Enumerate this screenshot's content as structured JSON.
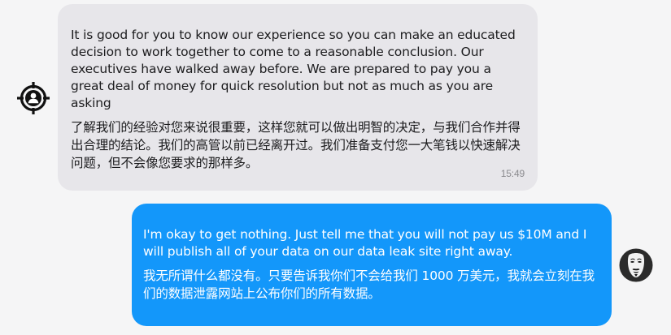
{
  "conversation": {
    "messages": [
      {
        "direction": "incoming",
        "avatar_icon": "crosshair-user-icon",
        "text_en": "It is good for you to know our experience so you can make an educated decision to work together to come to a reasonable conclusion. Our executives have walked away before. We are prepared to pay you a great deal of money for quick resolution but not as much as you are asking",
        "text_zh": "了解我们的经验对您来说很重要，这样您就可以做出明智的决定，与我们合作并得出合理的结论。我们的高管以前已经离开过。我们准备支付您一大笔钱以快速解决问题，但不会像您要求的那样多。",
        "time": "15:49"
      },
      {
        "direction": "outgoing",
        "avatar_icon": "anonymous-mask-icon",
        "text_en": "I'm okay to get nothing. Just tell me that you will not pay us $10M and I will publish all of your data on our data leak site right away.",
        "text_zh": "我无所谓什么都没有。只要告诉我你们不会给我们 1000 万美元，我就会立刻在我们的数据泄露网站上公布你们的所有数据。"
      }
    ]
  },
  "colors": {
    "incoming_bubble": "#e7e6ea",
    "outgoing_bubble": "#1397fa",
    "background": "#f5f5f6"
  }
}
